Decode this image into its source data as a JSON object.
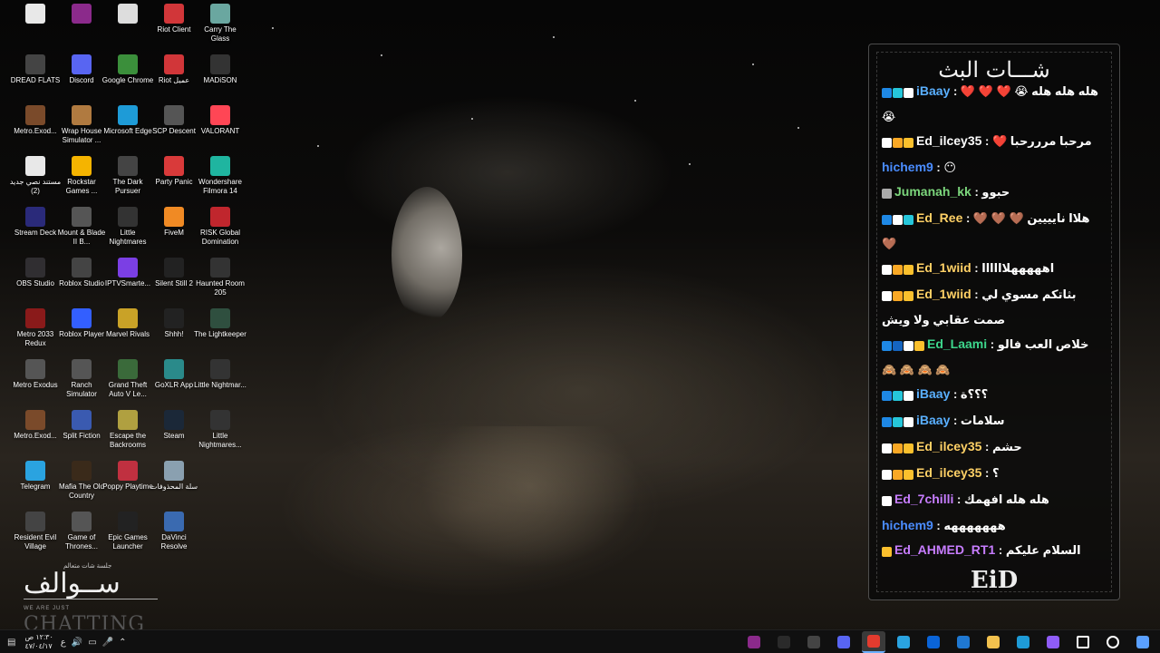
{
  "desktop": {
    "icons": [
      {
        "label": "",
        "icon": "document-icon",
        "color": "#e8e8e8"
      },
      {
        "label": "",
        "icon": "winrar-icon",
        "color": "#8b2a8b"
      },
      {
        "label": "",
        "icon": "app-icon",
        "color": "#dddddd"
      },
      {
        "label": "Riot Client",
        "icon": "riot-icon",
        "color": "#d13639"
      },
      {
        "label": "Carry The Glass",
        "icon": "game-icon",
        "color": "#6aa7a0"
      },
      {
        "label": "DREAD FLATS",
        "icon": "game-icon",
        "color": "#444444"
      },
      {
        "label": "Discord",
        "icon": "discord-icon",
        "color": "#5865f2"
      },
      {
        "label": "Google Chrome",
        "icon": "chrome-icon",
        "color": "#3b8f3b"
      },
      {
        "label": "Riot عميل",
        "icon": "riot-icon",
        "color": "#d13639"
      },
      {
        "label": "MADiSON",
        "icon": "game-icon",
        "color": "#333333"
      },
      {
        "label": "Metro.Exod...",
        "icon": "game-icon",
        "color": "#7a4a2a"
      },
      {
        "label": "Wrap House Simulator ...",
        "icon": "game-icon",
        "color": "#b07a40"
      },
      {
        "label": "Microsoft Edge",
        "icon": "edge-icon",
        "color": "#1e9bd7"
      },
      {
        "label": "SCP Descent",
        "icon": "game-icon",
        "color": "#555555"
      },
      {
        "label": "VALORANT",
        "icon": "valorant-icon",
        "color": "#ff4655"
      },
      {
        "label": "مستند نصي جديد (2)",
        "icon": "document-icon",
        "color": "#e8e8e8"
      },
      {
        "label": "Rockstar Games ...",
        "icon": "rockstar-icon",
        "color": "#f5b400"
      },
      {
        "label": "The Dark Pursuer",
        "icon": "game-icon",
        "color": "#444444"
      },
      {
        "label": "Party Panic",
        "icon": "game-icon",
        "color": "#d93a3a"
      },
      {
        "label": "Wondershare Filmora 14",
        "icon": "filmora-icon",
        "color": "#1fb5a0"
      },
      {
        "label": "Stream Deck",
        "icon": "streamdeck-icon",
        "color": "#2a2a7a"
      },
      {
        "label": "Mount & Blade II B...",
        "icon": "game-icon",
        "color": "#555555"
      },
      {
        "label": "Little Nightmares",
        "icon": "game-icon",
        "color": "#333333"
      },
      {
        "label": "FiveM",
        "icon": "fivem-icon",
        "color": "#f08a24"
      },
      {
        "label": "RISK Global Domination",
        "icon": "game-icon",
        "color": "#c0262d"
      },
      {
        "label": "OBS Studio",
        "icon": "obs-icon",
        "color": "#302e31"
      },
      {
        "label": "Roblox Studio",
        "icon": "roblox-icon",
        "color": "#444444"
      },
      {
        "label": "IPTVSmarte...",
        "icon": "iptv-icon",
        "color": "#7b3fe4"
      },
      {
        "label": "Silent Still 2",
        "icon": "game-icon",
        "color": "#222222"
      },
      {
        "label": "Haunted Room 205",
        "icon": "game-icon",
        "color": "#333333"
      },
      {
        "label": "Metro 2033 Redux",
        "icon": "game-icon",
        "color": "#8a1a1a"
      },
      {
        "label": "Roblox Player",
        "icon": "roblox-icon",
        "color": "#335fff"
      },
      {
        "label": "Marvel Rivals",
        "icon": "game-icon",
        "color": "#c9a227"
      },
      {
        "label": "Shhh!",
        "icon": "game-icon",
        "color": "#222222"
      },
      {
        "label": "The Lightkeeper",
        "icon": "game-icon",
        "color": "#2f4f3f"
      },
      {
        "label": "Metro Exodus",
        "icon": "game-icon",
        "color": "#555555"
      },
      {
        "label": "Ranch Simulator",
        "icon": "game-icon",
        "color": "#555555"
      },
      {
        "label": "Grand Theft Auto V Le...",
        "icon": "gta-icon",
        "color": "#3a6a3a"
      },
      {
        "label": "GoXLR App",
        "icon": "goxlr-icon",
        "color": "#2a8a8a"
      },
      {
        "label": "Little Nightmar...",
        "icon": "game-icon",
        "color": "#333333"
      },
      {
        "label": "Metro.Exod...",
        "icon": "game-icon",
        "color": "#7a4a2a"
      },
      {
        "label": "Split Fiction",
        "icon": "game-icon",
        "color": "#3a5ab0"
      },
      {
        "label": "Escape the Backrooms",
        "icon": "game-icon",
        "color": "#b0a040"
      },
      {
        "label": "Steam",
        "icon": "steam-icon",
        "color": "#1b2838"
      },
      {
        "label": "Little Nightmares...",
        "icon": "game-icon",
        "color": "#333333"
      },
      {
        "label": "Telegram",
        "icon": "telegram-icon",
        "color": "#2aa3e0"
      },
      {
        "label": "Mafia The Old Country",
        "icon": "game-icon",
        "color": "#3a2a1a"
      },
      {
        "label": "Poppy Playtime",
        "icon": "game-icon",
        "color": "#c03040"
      },
      {
        "label": "سلة المحذوفات",
        "icon": "recycle-bin-icon",
        "color": "#8aa0b0"
      },
      {
        "label": "",
        "icon": "",
        "color": ""
      },
      {
        "label": "Resident Evil Village",
        "icon": "game-icon",
        "color": "#444444"
      },
      {
        "label": "Game of Thrones...",
        "icon": "game-icon",
        "color": "#555555"
      },
      {
        "label": "Epic Games Launcher",
        "icon": "epic-icon",
        "color": "#222222"
      },
      {
        "label": "DaVinci Resolve",
        "icon": "davinci-icon",
        "color": "#3a6ab0"
      }
    ]
  },
  "chat": {
    "title": "شـــات البث",
    "messages": [
      {
        "user": "iBaay",
        "color": "#5ab0ff",
        "text": "هله هله هله 😭 ❤️ ❤️ ❤️ 😭",
        "badges": [
          "#1e88e5",
          "#26c6da",
          "#ffffff"
        ]
      },
      {
        "user": "Ed_ilcey35",
        "color": "#ffffff",
        "text": "مرحبا مرررحبا ❤️",
        "badges": [
          "#ffffff",
          "#f9a825",
          "#fbc02d"
        ]
      },
      {
        "user": "hichem9",
        "color": "#4a8cff",
        "text": "😶",
        "badges": []
      },
      {
        "user": "Jumanah_kk",
        "color": "#7cd67c",
        "text": "حبوو",
        "badges": [
          "#aaaaaa"
        ]
      },
      {
        "user": "Ed_Ree",
        "color": "#ffd166",
        "text": "هلاا نايييين 🤎 🤎 🤎 🤎",
        "badges": [
          "#1e88e5",
          "#ffffff",
          "#26c6da"
        ]
      },
      {
        "user": "Ed_1wiid",
        "color": "#ffd166",
        "text": "اهههههلاااااا",
        "badges": [
          "#ffffff",
          "#f9a825",
          "#fbc02d"
        ]
      },
      {
        "user": "Ed_1wiid",
        "color": "#ffd166",
        "text": "بثاتكم مسوي لي صمت عقابي ولا ويش",
        "badges": [
          "#ffffff",
          "#f9a825",
          "#fbc02d"
        ]
      },
      {
        "user": "Ed_Laami",
        "color": "#3dd68c",
        "text": "خلاص العب فالو",
        "badges": [
          "#1e88e5",
          "#1565c0",
          "#ffffff",
          "#fbc02d"
        ]
      },
      {
        "user": "",
        "color": "#ffffff",
        "text": "🙈 🙈 🙈 🙈",
        "badges": []
      },
      {
        "user": "iBaay",
        "color": "#5ab0ff",
        "text": "؟؟؟ة",
        "badges": [
          "#1e88e5",
          "#26c6da",
          "#ffffff"
        ]
      },
      {
        "user": "iBaay",
        "color": "#5ab0ff",
        "text": "سلامات",
        "badges": [
          "#1e88e5",
          "#26c6da",
          "#ffffff"
        ]
      },
      {
        "user": "Ed_ilcey35",
        "color": "#ffd166",
        "text": "حشم",
        "badges": [
          "#ffffff",
          "#f9a825",
          "#fbc02d"
        ]
      },
      {
        "user": "Ed_ilcey35",
        "color": "#ffd166",
        "text": "؟",
        "badges": [
          "#ffffff",
          "#f9a825",
          "#fbc02d"
        ]
      },
      {
        "user": "Ed_7chilli",
        "color": "#c77dff",
        "text": "هله هله افهمك",
        "badges": [
          "#ffffff"
        ]
      },
      {
        "user": "hichem9",
        "color": "#4a8cff",
        "text": "هههههههه",
        "badges": []
      },
      {
        "user": "Ed_AHMED_RT1",
        "color": "#c77dff",
        "text": "السلام عليكم ورحمة الله وبركاته ارحب يا عيد وشات واطلق ناس الشووق مليوونن ♥ 👀",
        "badges": [
          "#fbc02d"
        ]
      }
    ],
    "logo": "EiD"
  },
  "branding": {
    "subtitle": "جلسة شات متعالم",
    "arabic": "ســوالف",
    "small": "WE ARE JUST",
    "big": "CHATTING"
  },
  "taskbar": {
    "clock_time": "١٢:٣٠ ص",
    "clock_date": "٤٧/٠٤/١٧",
    "lang": "ع",
    "pinned": [
      {
        "name": "winrar",
        "color": "#8b2a8b",
        "active": false
      },
      {
        "name": "xbox",
        "color": "#2a2a2a",
        "active": false
      },
      {
        "name": "obs",
        "color": "#444444",
        "active": false
      },
      {
        "name": "discord",
        "color": "#5865f2",
        "active": false
      },
      {
        "name": "chrome",
        "color": "#e33b2e",
        "active": true
      },
      {
        "name": "telegram",
        "color": "#2aa3e0",
        "active": false
      },
      {
        "name": "outlook",
        "color": "#0a64d8",
        "active": false
      },
      {
        "name": "store",
        "color": "#1f78d1",
        "active": false
      },
      {
        "name": "explorer",
        "color": "#f2c14e",
        "active": false
      },
      {
        "name": "edge",
        "color": "#1e9bd7",
        "active": false
      },
      {
        "name": "copilot",
        "color": "#8f5cf7",
        "active": false
      },
      {
        "name": "task-view",
        "color": "#ffffff",
        "active": false
      },
      {
        "name": "search",
        "color": "#ffffff",
        "active": false
      },
      {
        "name": "start",
        "color": "#5aa0ff",
        "active": false
      }
    ]
  }
}
